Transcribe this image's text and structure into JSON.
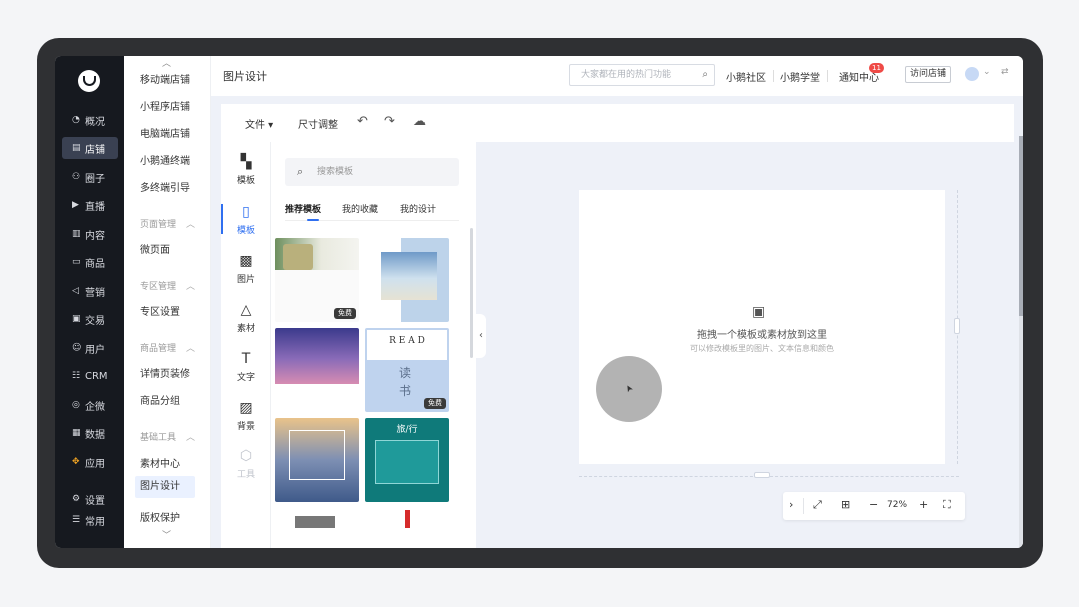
{
  "nav": {
    "items": [
      {
        "label": "概况",
        "icon": "◔"
      },
      {
        "label": "店铺",
        "icon": "▤"
      },
      {
        "label": "圈子",
        "icon": "⚇"
      },
      {
        "label": "直播",
        "icon": "▶"
      },
      {
        "label": "内容",
        "icon": "▥"
      },
      {
        "label": "商品",
        "icon": "▭"
      },
      {
        "label": "营销",
        "icon": "◁"
      },
      {
        "label": "交易",
        "icon": "▣"
      },
      {
        "label": "用户",
        "icon": "☺"
      },
      {
        "label": "CRM",
        "icon": "☷"
      },
      {
        "label": "企微",
        "icon": "◎"
      },
      {
        "label": "数据",
        "icon": "▦"
      },
      {
        "label": "应用",
        "icon": "✥"
      }
    ],
    "settings": {
      "label": "设置",
      "icon": "⚙"
    },
    "common": {
      "label": "常用",
      "icon": "☰"
    }
  },
  "subnav": {
    "store": [
      "移动端店铺",
      "小程序店铺",
      "电脑端店铺",
      "小鹅通终端",
      "多终端引导"
    ],
    "page_head": "页面管理",
    "page_items": [
      "微页面"
    ],
    "zone_head": "专区管理",
    "zone_items": [
      "专区设置"
    ],
    "goods_head": "商品管理",
    "goods_items": [
      "详情页装修",
      "商品分组"
    ],
    "tools_head": "基础工具",
    "tools_items": [
      "素材中心",
      "图片设计",
      "版权保护"
    ]
  },
  "header": {
    "title": "图片设计",
    "search_placeholder": "大家都在用的热门功能",
    "links": [
      "小鹅社区",
      "小鹅学堂",
      "通知中心"
    ],
    "badge": "11",
    "visit_store": "访问店铺"
  },
  "toolbar": {
    "file": "文件 ▾",
    "resize": "尺寸调整"
  },
  "tools": [
    "模板",
    "模板",
    "图片",
    "素材",
    "文字",
    "背景",
    "工具"
  ],
  "panel": {
    "search_placeholder": "搜索模板",
    "tabs": [
      "推荐模板",
      "我的收藏",
      "我的设计"
    ],
    "free_label": "免费",
    "read_word": "R E A D",
    "read_cn1": "读",
    "read_cn2": "书",
    "travel_word": "旅/行"
  },
  "canvas": {
    "hint": "拖拽一个模板或素材放到这里",
    "subhint": "可以修改模板里的图片、文本信息和颜色"
  },
  "zoom": {
    "value": "72%"
  },
  "colors": {
    "accent": "#2f6ff0",
    "nav_bg": "#16191f",
    "badge": "#ef4a46"
  }
}
